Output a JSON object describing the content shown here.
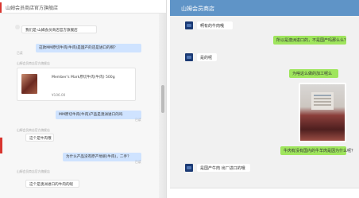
{
  "left_panel": {
    "title": "山姆会员商店官方旗舰店",
    "messages": [
      {
        "side": "left",
        "text": "我们是·山姆会员商店官方旗舰店"
      },
      {
        "side": "right",
        "text": "这款MM原切牛肉(牛肉)是国产的还是进口的啊？",
        "meta": "已读"
      },
      {
        "side": "left",
        "meta": "山姆会员商店官方旗舰店",
        "card": {
          "name": "Member's Mark原切牛肉(牛肉) 500g",
          "price": "¥106.00"
        }
      },
      {
        "side": "right",
        "text": "MM原切牛肉(牛肉)产品是澳洲进口的吗",
        "meta": "已读"
      },
      {
        "side": "left",
        "meta": "山姆会员商店官方旗舰店",
        "text": "这个是牛肉哦"
      },
      {
        "side": "right",
        "text": "为什么产品没有原产地呢(牛肉)，二手？",
        "meta": "已读"
      },
      {
        "side": "left",
        "meta": "山姆会员商店官方旗舰店",
        "text": "这个是澳洲进口的牛肉的呢"
      }
    ]
  },
  "right_panel": {
    "title": "山姆会员商店",
    "messages": [
      {
        "side": "left",
        "text": "啊有的牛肉哦"
      },
      {
        "side": "right",
        "text": "所以是澳洲进口的，不是国产吗那么么？"
      },
      {
        "side": "left",
        "text": "是的呢"
      },
      {
        "side": "right",
        "text": "为啥这么做的加工呢么"
      },
      {
        "side": "right",
        "image": "beef-package-photo"
      },
      {
        "side": "right",
        "text": "牛肉有没有国内的牛羊肉是因为什么呢？"
      },
      {
        "side": "left",
        "text": "是国产牛肉 出厂进口的哦"
      }
    ]
  },
  "colors": {
    "header_blue": "#5f94c7",
    "bubble_green": "#9fe55d",
    "bubble_blue": "#cfe3ff",
    "accent_red": "#d8352f",
    "avatar_navy": "#1b3a74"
  }
}
